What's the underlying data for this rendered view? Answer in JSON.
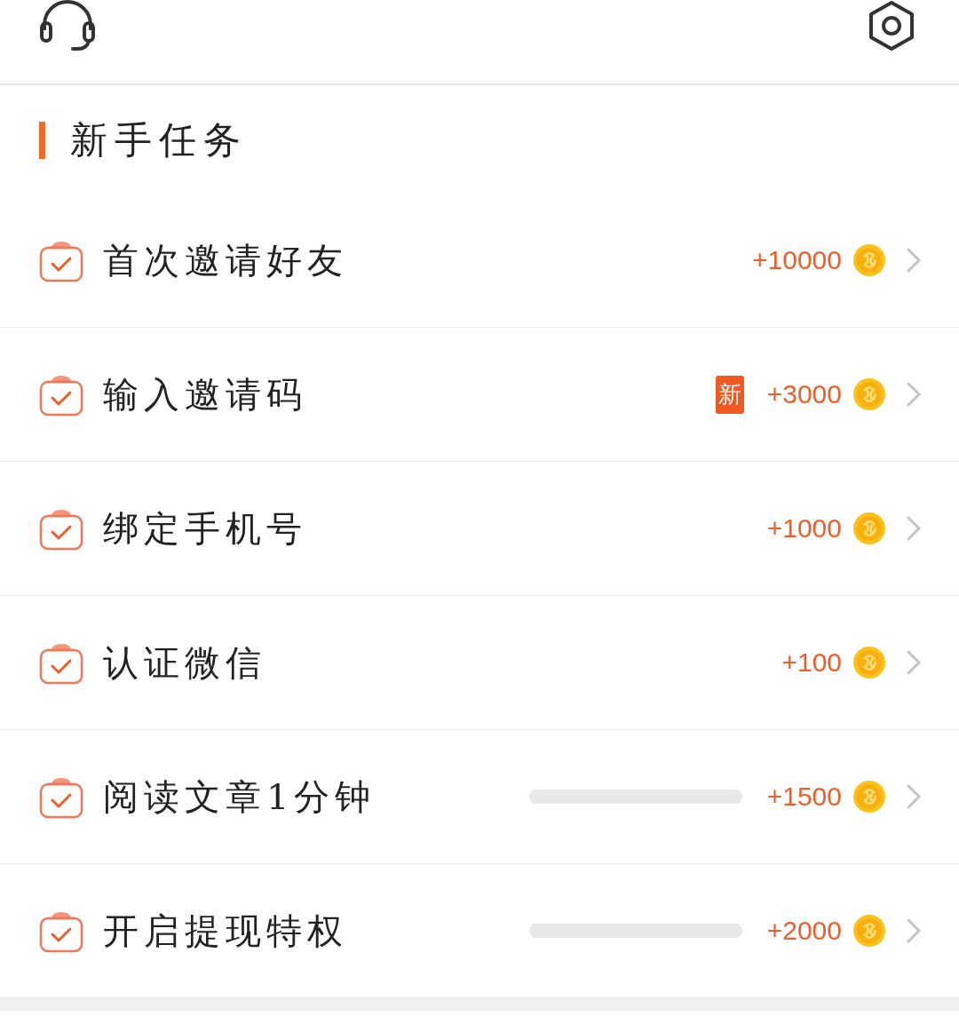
{
  "section_title": "新手任务",
  "tasks": [
    {
      "kind": "plain",
      "title": "首次邀请好友",
      "reward": "+10000"
    },
    {
      "kind": "plain",
      "title": "输入邀请码",
      "badge": "新",
      "reward": "+3000"
    },
    {
      "kind": "plain",
      "title": "绑定手机号",
      "reward": "+1000"
    },
    {
      "kind": "plain",
      "title": "认证微信",
      "reward": "+100"
    },
    {
      "kind": "progress",
      "title": "阅读文章1分钟",
      "reward": "+1500"
    },
    {
      "kind": "progress",
      "title": "开启提现特权",
      "reward": "+2000"
    }
  ]
}
